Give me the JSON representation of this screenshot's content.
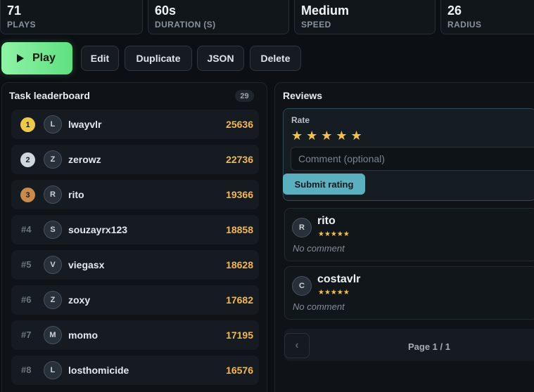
{
  "stats": [
    {
      "value": "71",
      "label": "PLAYS"
    },
    {
      "value": "60s",
      "label": "DURATION (S)"
    },
    {
      "value": "Medium",
      "label": "SPEED"
    },
    {
      "value": "26",
      "label": "RADIUS"
    }
  ],
  "actions": {
    "play": "Play",
    "edit": "Edit",
    "duplicate": "Duplicate",
    "json": "JSON",
    "delete": "Delete"
  },
  "leaderboard": {
    "title": "Task leaderboard",
    "count": "29",
    "rows": [
      {
        "rank": "1",
        "initial": "L",
        "name": "lwayvlr",
        "score": "25636"
      },
      {
        "rank": "2",
        "initial": "Z",
        "name": "zerowz",
        "score": "22736"
      },
      {
        "rank": "3",
        "initial": "R",
        "name": "rito",
        "score": "19366"
      },
      {
        "rank": "#4",
        "initial": "S",
        "name": "souzayrx123",
        "score": "18858"
      },
      {
        "rank": "#5",
        "initial": "V",
        "name": "viegasx",
        "score": "18628"
      },
      {
        "rank": "#6",
        "initial": "Z",
        "name": "zoxy",
        "score": "17682"
      },
      {
        "rank": "#7",
        "initial": "M",
        "name": "momo",
        "score": "17195"
      },
      {
        "rank": "#8",
        "initial": "L",
        "name": "losthomicide",
        "score": "16576"
      }
    ]
  },
  "reviews": {
    "title": "Reviews",
    "rate_label": "Rate",
    "rating_stars": "★ ★ ★ ★ ★",
    "comment_placeholder": "Comment (optional)",
    "submit_label": "Submit rating",
    "items": [
      {
        "initial": "R",
        "name": "rito",
        "stars": "★★★★★",
        "comment": "No comment"
      },
      {
        "initial": "C",
        "name": "costavlr",
        "stars": "★★★★★",
        "comment": "No comment"
      }
    ],
    "pager": {
      "prev": "‹",
      "text": "Page 1 / 1"
    }
  },
  "colors": {
    "play_button": "#5fe080",
    "score": "#f4b84d",
    "gold": "#f0c94a",
    "silver": "#cfd6dc",
    "bronze": "#c98a4a",
    "submit_button": "#5bb0c0",
    "star": "#f6c144"
  }
}
